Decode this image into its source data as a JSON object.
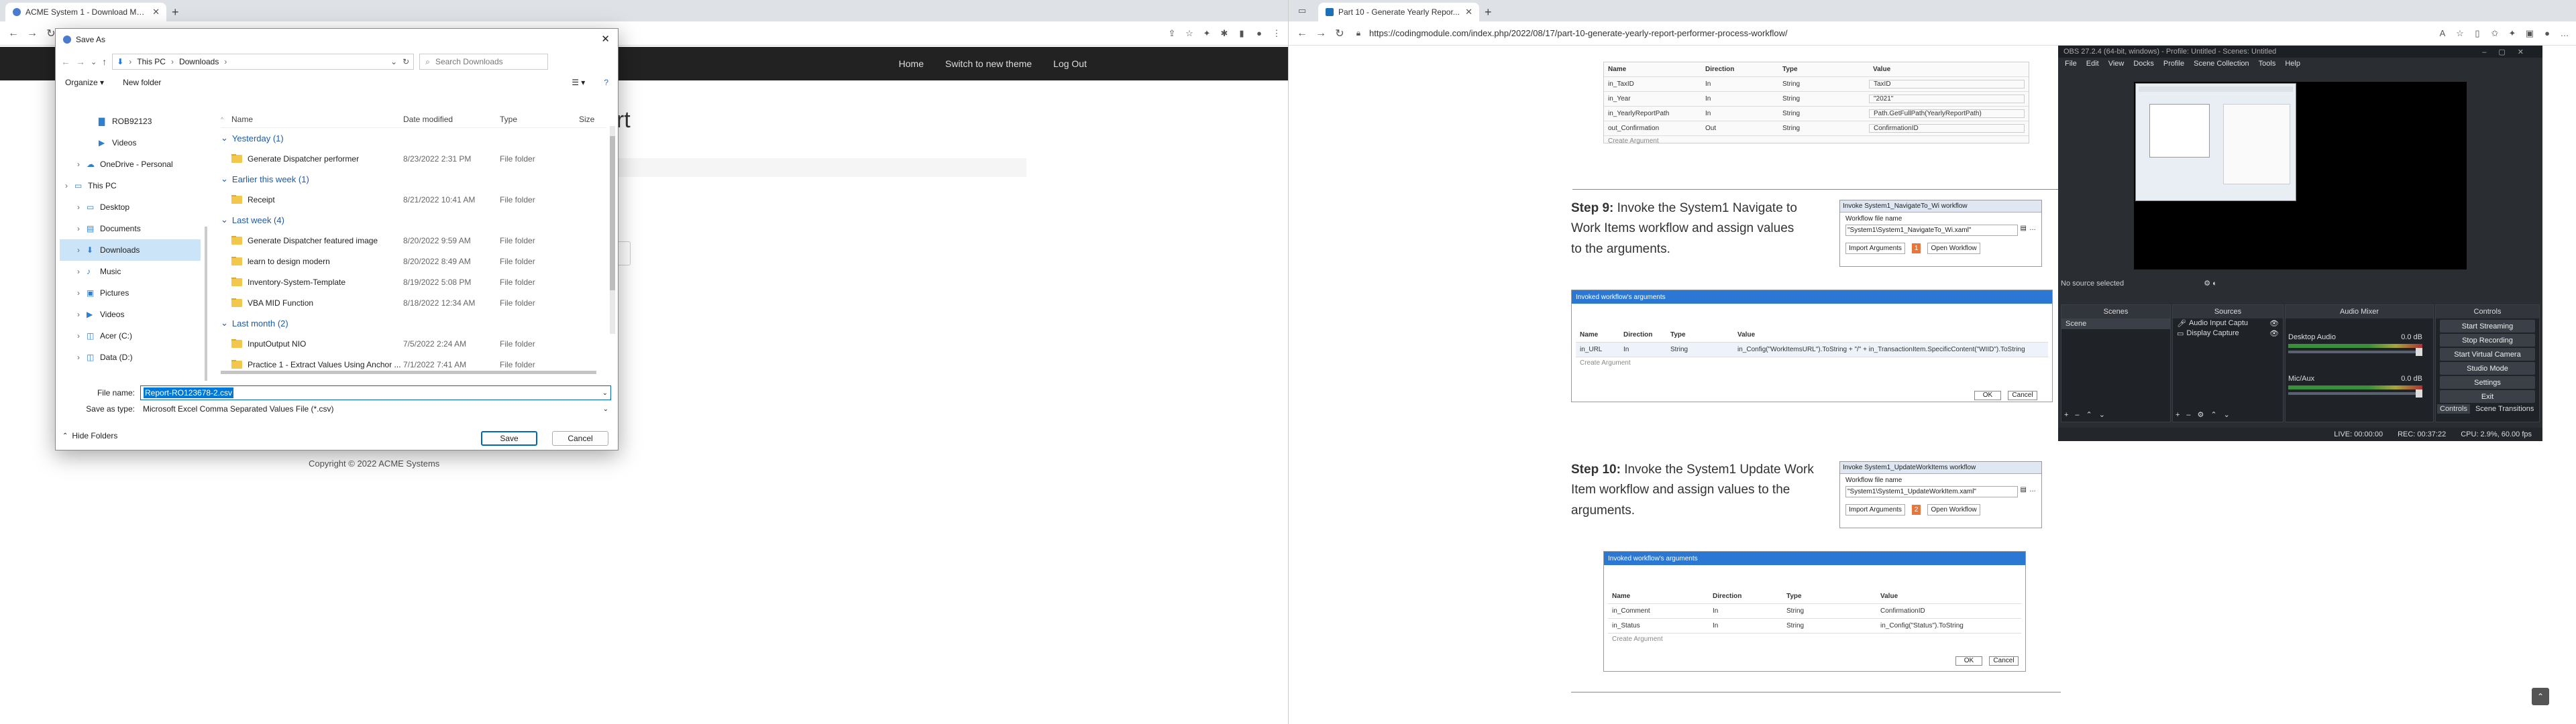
{
  "left_browser": {
    "tab_title": "ACME System 1 - Download Mo...",
    "url": "",
    "nav_links": [
      "Home",
      "Switch to new theme",
      "Log Out"
    ],
    "page_partial_heading": "ort",
    "footer": "Copyright © 2022 ACME Systems"
  },
  "save_dialog": {
    "title": "Save As",
    "breadcrumb": [
      "This PC",
      "Downloads"
    ],
    "search_placeholder": "Search Downloads",
    "organize_label": "Organize",
    "new_folder_label": "New folder",
    "tree": [
      {
        "label": "ROB92123",
        "indent": 2,
        "icon": "folder"
      },
      {
        "label": "Videos",
        "indent": 2,
        "icon": "videos"
      },
      {
        "label": "OneDrive - Personal",
        "indent": 1,
        "icon": "cloud"
      },
      {
        "label": "This PC",
        "indent": 0,
        "icon": "pc"
      },
      {
        "label": "Desktop",
        "indent": 1,
        "icon": "desktop"
      },
      {
        "label": "Documents",
        "indent": 1,
        "icon": "documents"
      },
      {
        "label": "Downloads",
        "indent": 1,
        "icon": "downloads",
        "selected": true
      },
      {
        "label": "Music",
        "indent": 1,
        "icon": "music"
      },
      {
        "label": "Pictures",
        "indent": 1,
        "icon": "pictures"
      },
      {
        "label": "Videos",
        "indent": 1,
        "icon": "videos"
      },
      {
        "label": "Acer (C:)",
        "indent": 1,
        "icon": "drive"
      },
      {
        "label": "Data (D:)",
        "indent": 1,
        "icon": "drive"
      }
    ],
    "columns": [
      "Name",
      "Date modified",
      "Type",
      "Size"
    ],
    "groups": [
      {
        "label": "Yesterday (1)",
        "items": [
          {
            "name": "Generate Dispatcher performer",
            "date": "8/23/2022 2:31 PM",
            "type": "File folder"
          }
        ]
      },
      {
        "label": "Earlier this week (1)",
        "items": [
          {
            "name": "Receipt",
            "date": "8/21/2022 10:41 AM",
            "type": "File folder"
          }
        ]
      },
      {
        "label": "Last week (4)",
        "items": [
          {
            "name": "Generate Dispatcher featured image",
            "date": "8/20/2022 9:59 AM",
            "type": "File folder"
          },
          {
            "name": "learn to design modern",
            "date": "8/20/2022 8:49 AM",
            "type": "File folder"
          },
          {
            "name": "Inventory-System-Template",
            "date": "8/19/2022 5:08 PM",
            "type": "File folder"
          },
          {
            "name": "VBA MID Function",
            "date": "8/18/2022 12:34 AM",
            "type": "File folder"
          }
        ]
      },
      {
        "label": "Last month (2)",
        "items": [
          {
            "name": "InputOutput NIO",
            "date": "7/5/2022 2:24 AM",
            "type": "File folder"
          },
          {
            "name": "Practice 1 - Extract Values Using Anchor ...",
            "date": "7/1/2022 7:41 AM",
            "type": "File folder"
          }
        ]
      }
    ],
    "file_name_label": "File name:",
    "file_name_value": "Report-RO123678-2.csv",
    "save_type_label": "Save as type:",
    "save_type_value": "Microsoft Excel Comma Separated Values File (*.csv)",
    "hide_folders_label": "Hide Folders",
    "save_label": "Save",
    "cancel_label": "Cancel"
  },
  "right_browser": {
    "tab_title": "Part 10 - Generate Yearly Repor...",
    "url": "https://codingmodule.com/index.php/2022/08/17/part-10-generate-yearly-report-performer-process-workflow/",
    "top_table": {
      "columns": [
        "Name",
        "Direction",
        "Type",
        "Value"
      ],
      "rows": [
        [
          "in_TaxID",
          "In",
          "String",
          "TaxID"
        ],
        [
          "in_Year",
          "In",
          "String",
          "\"2021\""
        ],
        [
          "in_YearlyReportPath",
          "In",
          "String",
          "Path.GetFullPath(YearlyReportPath)"
        ],
        [
          "out_Confirmation",
          "Out",
          "String",
          "ConfirmationID"
        ]
      ],
      "create_label": "Create Argument"
    },
    "step9": {
      "bold": "Step 9:",
      "text": " Invoke the System1 Navigate to Work Items workflow and assign values to the arguments.",
      "activity_title": "Invoke System1_NavigateTo_Wi workflow",
      "file_label": "Workflow file name",
      "file_value": "\"System1\\System1_NavigateTo_Wi.xaml\"",
      "import_label": "Import Arguments",
      "import_count": "1",
      "open_label": "Open Workflow",
      "dialog_title": "Invoked workflow's arguments",
      "columns": [
        "Name",
        "Direction",
        "Type",
        "Value"
      ],
      "rows": [
        [
          "in_URL",
          "In",
          "String",
          "in_Config(\"WorkItemsURL\").ToString + \"/\" + in_TransactionItem.SpecificContent(\"WIID\").ToString"
        ]
      ],
      "create_label": "Create Argument",
      "ok_label": "OK",
      "cancel_label": "Cancel"
    },
    "step10": {
      "bold": "Step 10:",
      "text": " Invoke the System1 Update Work Item workflow and assign values to the arguments.",
      "activity_title": "Invoke System1_UpdateWorkItems workflow",
      "file_label": "Workflow file name",
      "file_value": "\"System1\\System1_UpdateWorkItem.xaml\"",
      "import_label": "Import Arguments",
      "import_count": "2",
      "open_label": "Open Workflow",
      "dialog_title": "Invoked workflow's arguments",
      "columns": [
        "Name",
        "Direction",
        "Type",
        "Value"
      ],
      "rows": [
        [
          "in_Comment",
          "In",
          "String",
          "ConfirmationID"
        ],
        [
          "in_Status",
          "In",
          "String",
          "in_Config(\"Status\").ToString"
        ]
      ],
      "create_label": "Create Argument",
      "ok_label": "OK",
      "cancel_label": "Cancel"
    }
  },
  "obs": {
    "title": "OBS 27.2.4 (64-bit, windows) - Profile: Untitled - Scenes: Untitled",
    "menu": [
      "File",
      "Edit",
      "View",
      "Docks",
      "Profile",
      "Scene Collection",
      "Tools",
      "Help"
    ],
    "no_source": "No source selected",
    "docks": [
      "Scenes",
      "Sources",
      "Audio Mixer",
      "Controls"
    ],
    "scene_item": "Scene",
    "sources": [
      "Audio Input Captu",
      "Display Capture"
    ],
    "mixer": [
      {
        "label": "Desktop Audio",
        "db": "0.0 dB"
      },
      {
        "label": "Mic/Aux",
        "db": "0.0 dB"
      }
    ],
    "controls": [
      "Start Streaming",
      "Stop Recording",
      "Start Virtual Camera",
      "Studio Mode",
      "Settings",
      "Exit"
    ],
    "tabs": [
      "Controls",
      "Scene Transitions"
    ],
    "status": {
      "live": "LIVE: 00:00:00",
      "rec": "REC: 00:37:22",
      "cpu": "CPU: 2.9%, 60.00 fps"
    }
  }
}
